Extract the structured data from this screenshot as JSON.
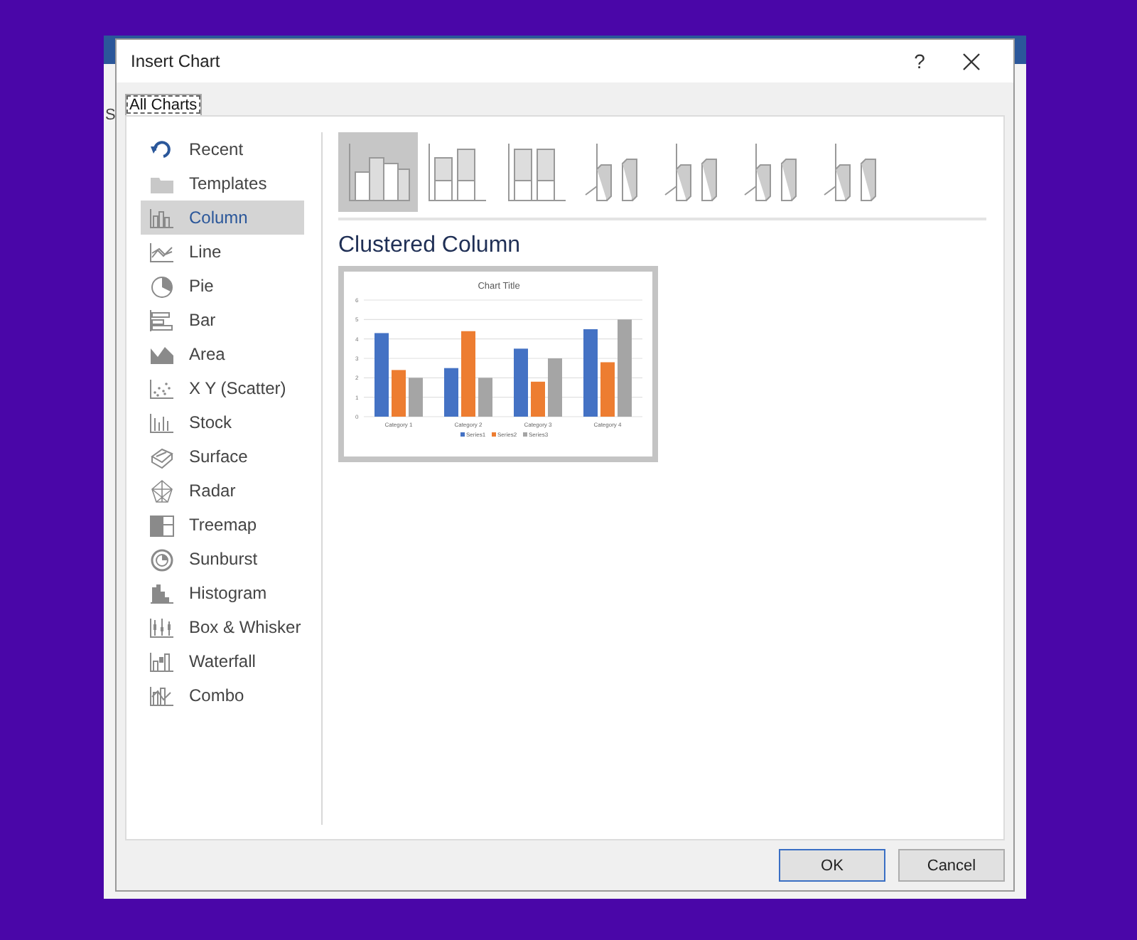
{
  "background_window": {
    "left_text": "S"
  },
  "window": {
    "title": "Insert Chart",
    "help": "?"
  },
  "tabs": [
    {
      "label": "All Charts",
      "selected": true
    }
  ],
  "sidebar": {
    "items": [
      {
        "label": "Recent",
        "selected": false
      },
      {
        "label": "Templates",
        "selected": false
      },
      {
        "label": "Column",
        "selected": true
      },
      {
        "label": "Line",
        "selected": false
      },
      {
        "label": "Pie",
        "selected": false
      },
      {
        "label": "Bar",
        "selected": false
      },
      {
        "label": "Area",
        "selected": false
      },
      {
        "label": "X Y (Scatter)",
        "selected": false
      },
      {
        "label": "Stock",
        "selected": false
      },
      {
        "label": "Surface",
        "selected": false
      },
      {
        "label": "Radar",
        "selected": false
      },
      {
        "label": "Treemap",
        "selected": false
      },
      {
        "label": "Sunburst",
        "selected": false
      },
      {
        "label": "Histogram",
        "selected": false
      },
      {
        "label": "Box & Whisker",
        "selected": false
      },
      {
        "label": "Waterfall",
        "selected": false
      },
      {
        "label": "Combo",
        "selected": false
      }
    ]
  },
  "subtypes": [
    {
      "selected": true
    },
    {
      "selected": false
    },
    {
      "selected": false
    },
    {
      "selected": false
    },
    {
      "selected": false
    },
    {
      "selected": false
    },
    {
      "selected": false
    }
  ],
  "preview": {
    "heading": "Clustered Column",
    "chart_data": {
      "type": "bar",
      "title": "Chart Title",
      "categories": [
        "Category 1",
        "Category 2",
        "Category 3",
        "Category 4"
      ],
      "series": [
        {
          "name": "Series1",
          "color": "#4472c4",
          "values": [
            4.3,
            2.5,
            3.5,
            4.5
          ]
        },
        {
          "name": "Series2",
          "color": "#ed7d31",
          "values": [
            2.4,
            4.4,
            1.8,
            2.8
          ]
        },
        {
          "name": "Series3",
          "color": "#a5a5a5",
          "values": [
            2,
            2,
            3,
            5
          ]
        }
      ],
      "ylim": [
        0,
        6
      ],
      "yticks": [
        0,
        1,
        2,
        3,
        4,
        5,
        6
      ],
      "grid": true,
      "legend": "bottom"
    }
  },
  "buttons": [
    {
      "label": "OK",
      "kind": "default"
    },
    {
      "label": "Cancel",
      "kind": "normal"
    }
  ]
}
